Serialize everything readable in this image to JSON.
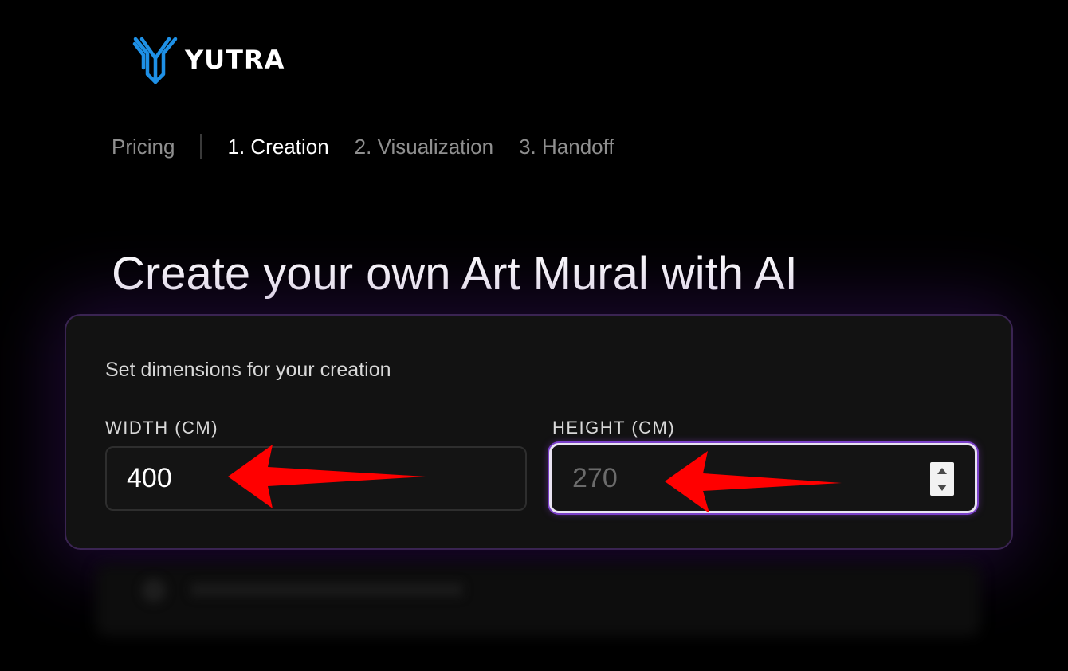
{
  "brand": {
    "name": "YUTRA",
    "accent_color": "#1e90e6"
  },
  "nav": {
    "pricing": "Pricing",
    "steps": [
      "1. Creation",
      "2. Visualization",
      "3. Handoff"
    ],
    "active_step": "1. Creation"
  },
  "page": {
    "title": "Create your own Art Mural with AI"
  },
  "dimensions": {
    "subtitle": "Set dimensions for your creation",
    "width": {
      "label": "WIDTH (CM)",
      "value": "400"
    },
    "height": {
      "label": "HEIGHT (CM)",
      "placeholder": "270",
      "focused": true
    }
  },
  "annotations": {
    "arrow_color": "#ff0000",
    "arrow_icon": "red-arrow-left"
  }
}
